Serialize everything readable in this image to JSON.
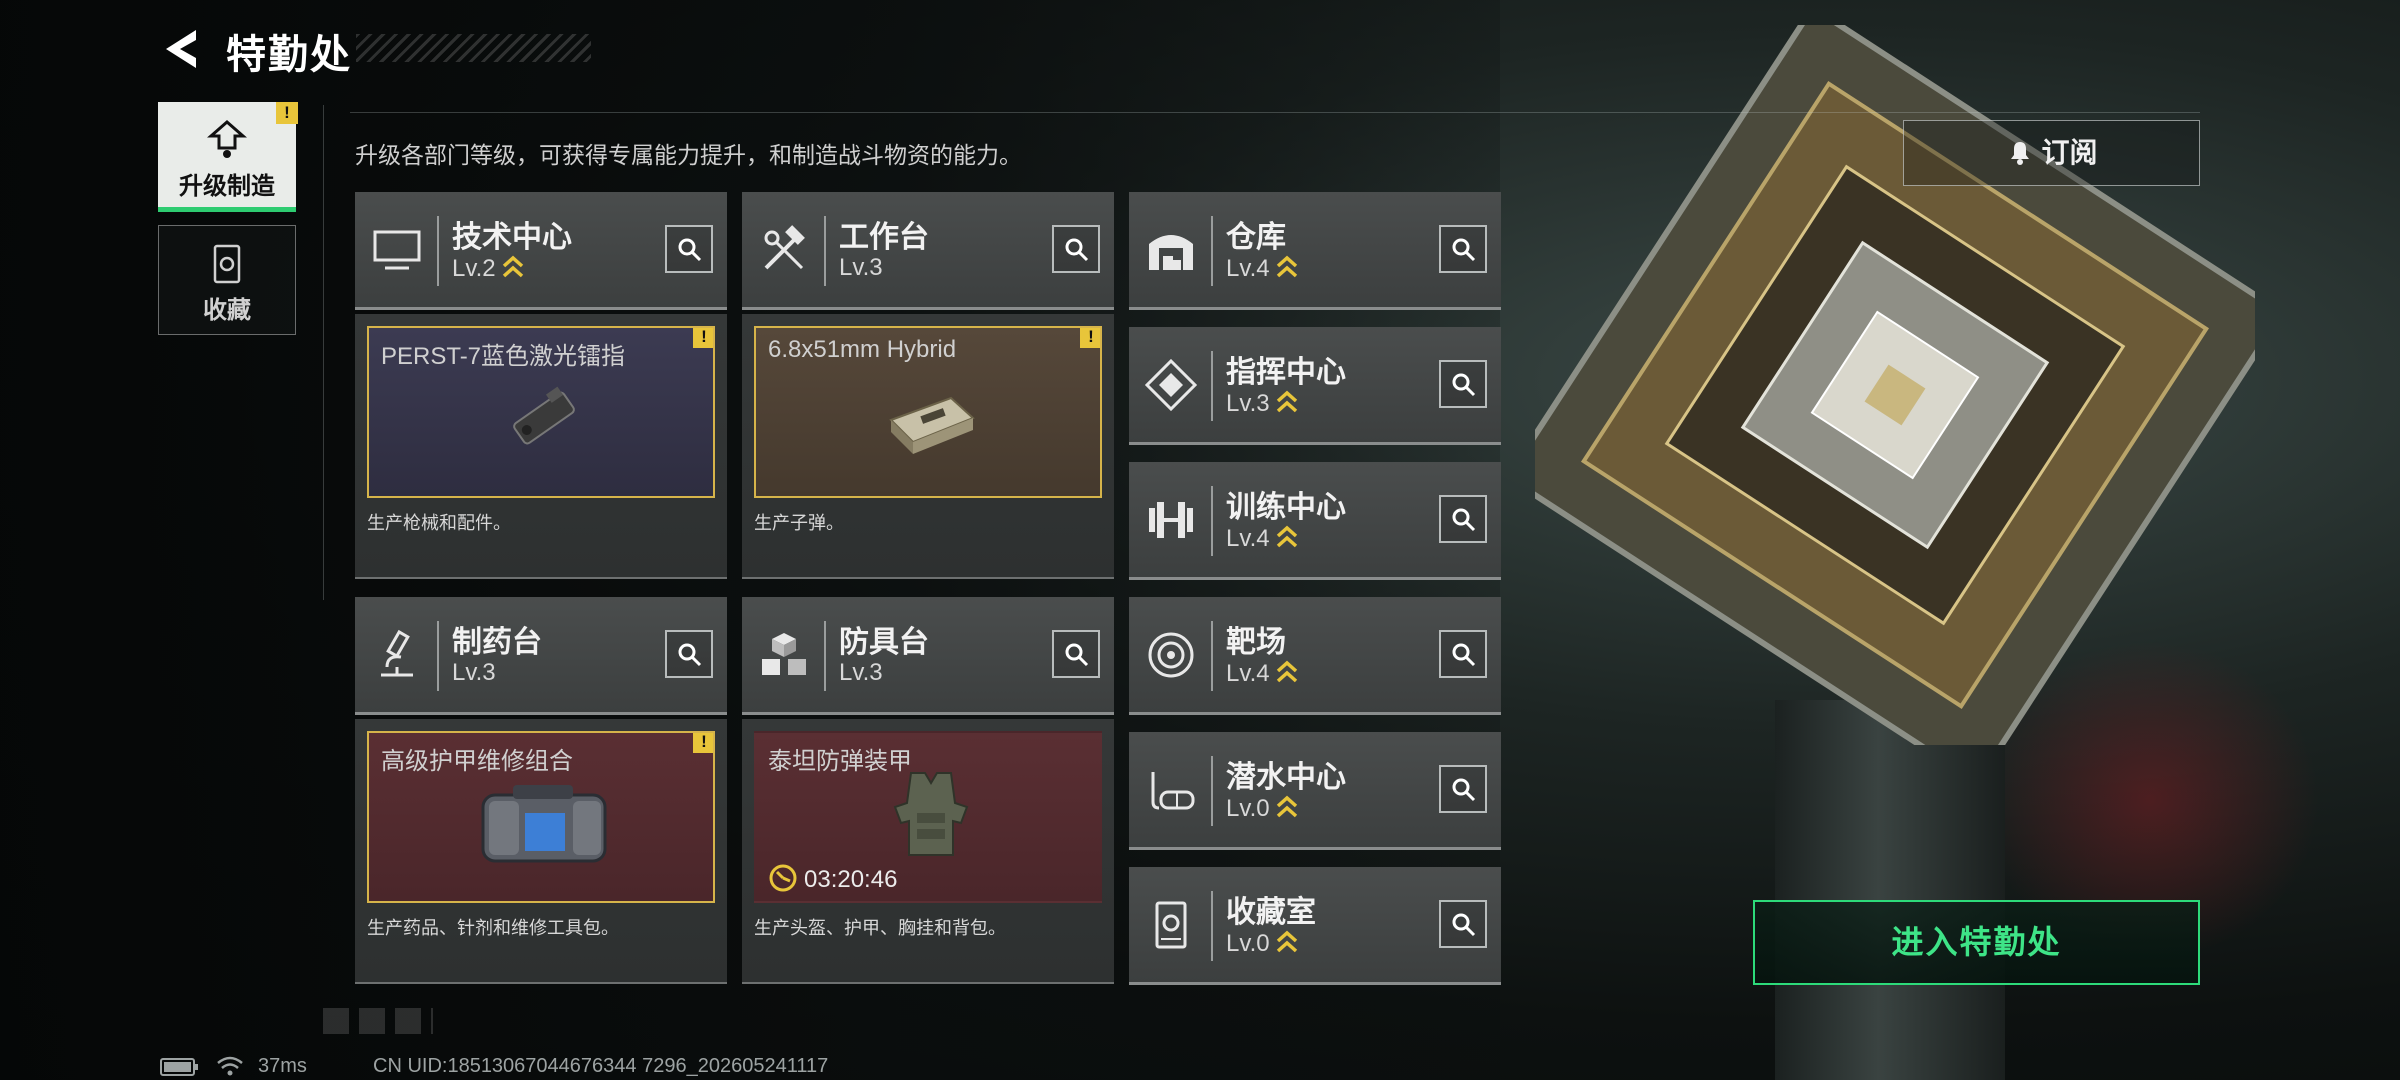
{
  "header": {
    "title": "特勤处"
  },
  "subtitle": "升级各部门等级，可获得专属能力提升，和制造战斗物资的能力。",
  "side_tabs": [
    {
      "label": "升级制造",
      "active": true,
      "badge": "!"
    },
    {
      "label": "收藏",
      "active": false
    }
  ],
  "buildings_left": [
    {
      "name": "技术中心",
      "level": "Lv.2",
      "upgradable": true,
      "icon": "monitor-icon",
      "production": {
        "item": "PERST-7蓝色激光镭指",
        "desc": "生产枪械和配件。",
        "badge": "!",
        "slot_color": "purple"
      }
    },
    {
      "name": "工作台",
      "level": "Lv.3",
      "upgradable": false,
      "icon": "tools-icon",
      "production": {
        "item": "6.8x51mm Hybrid",
        "desc": "生产子弹。",
        "badge": "!",
        "slot_color": "brown"
      }
    },
    {
      "name": "制药台",
      "level": "Lv.3",
      "upgradable": false,
      "icon": "microscope-icon",
      "production": {
        "item": "高级护甲维修组合",
        "desc": "生产药品、针剂和维修工具包。",
        "badge": "!",
        "slot_color": "red"
      }
    },
    {
      "name": "防具台",
      "level": "Lv.3",
      "upgradable": false,
      "icon": "cubes-icon",
      "production": {
        "item": "泰坦防弹装甲",
        "desc": "生产头盔、护甲、胸挂和背包。",
        "timer": "03:20:46",
        "slot_color": "red"
      }
    }
  ],
  "buildings_right": [
    {
      "name": "仓库",
      "level": "Lv.4",
      "upgradable": true,
      "icon": "warehouse-icon"
    },
    {
      "name": "指挥中心",
      "level": "Lv.3",
      "upgradable": true,
      "icon": "command-icon"
    },
    {
      "name": "训练中心",
      "level": "Lv.4",
      "upgradable": true,
      "icon": "dumbbell-icon"
    },
    {
      "name": "靶场",
      "level": "Lv.4",
      "upgradable": true,
      "icon": "target-icon"
    },
    {
      "name": "潜水中心",
      "level": "Lv.0",
      "upgradable": true,
      "icon": "diving-mask-icon"
    },
    {
      "name": "收藏室",
      "level": "Lv.0",
      "upgradable": true,
      "icon": "collection-icon"
    }
  ],
  "subscribe_label": "订阅",
  "enter_label": "进入特勤处",
  "status": {
    "ping": "37ms",
    "uid": "CN UID:18513067044676344 7296_202605241117"
  },
  "colors": {
    "accent_green": "#2ddb7a",
    "badge_yellow": "#e8c53a",
    "slot_border": "#d6b44a"
  }
}
